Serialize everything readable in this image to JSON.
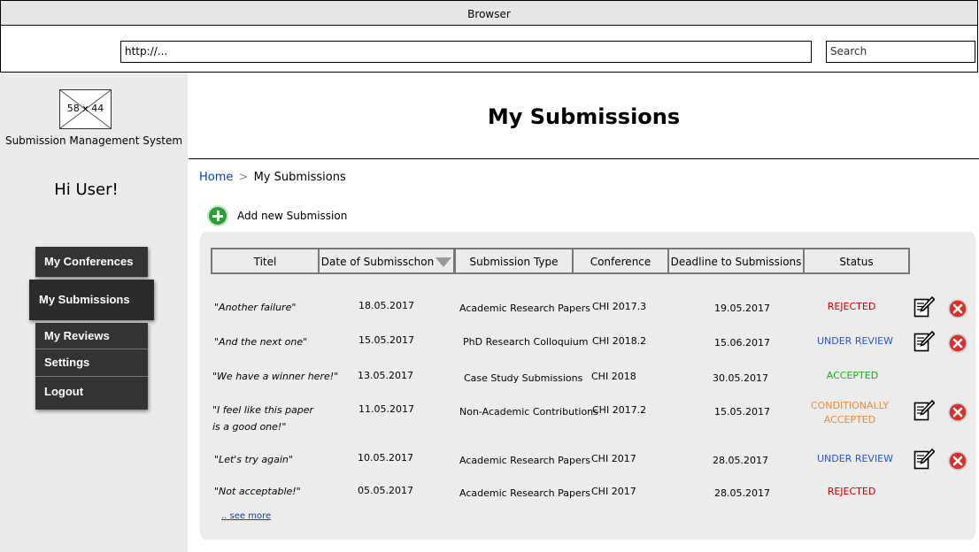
{
  "browser": {
    "title": "Browser",
    "url": "http://...",
    "search_placeholder": "Search"
  },
  "sidebar": {
    "logo_placeholder": "58 x 44",
    "app_name": "Submission Management System",
    "greeting": "Hi User!",
    "nav": [
      {
        "label": "My Conferences"
      },
      {
        "label": "My Submissions",
        "active": true
      },
      {
        "label": "My Reviews"
      },
      {
        "label": "Settings"
      },
      {
        "label": "Logout"
      }
    ]
  },
  "main": {
    "title": "My Submissions",
    "breadcrumb": {
      "home": "Home",
      "separator": ">",
      "current": "My Submissions"
    },
    "add_button": "Add new Submission",
    "table": {
      "headers": [
        "Titel",
        "Date of Submisschon",
        "Submission Type",
        "Conference",
        "Deadline to Submissions",
        "Status"
      ],
      "rows": [
        {
          "title": "\"Another failure\"",
          "date": "18.05.2017",
          "type": "Academic Research Papers",
          "conference": "CHI 2017.3",
          "deadline": "19.05.2017",
          "status": "REJECTED"
        },
        {
          "title": "\"And the next one\"",
          "date": "15.05.2017",
          "type": "PhD Research Colloquium",
          "conference": "CHI 2018.2",
          "deadline": "15.06.2017",
          "status": "UNDER REVIEW"
        },
        {
          "title": "\"We have a winner here!\"",
          "date": "13.05.2017",
          "type": "Case Study Submissions",
          "conference": "CHI 2018",
          "deadline": "30.05.2017",
          "status": "ACCEPTED"
        },
        {
          "title_line1": "\"I feel like this paper",
          "title_line2": "is a good one!\"",
          "date": "11.05.2017",
          "type": "Non-Academic Contributions",
          "conference": "CHI 2017.2",
          "deadline": "15.05.2017",
          "status_line1": "CONDITIONALLY",
          "status_line2": "ACCEPTED"
        },
        {
          "title": "\"Let's try again\"",
          "date": "10.05.2017",
          "type": "Academic Research Papers",
          "conference": "CHI 2017",
          "deadline": "28.05.2017",
          "status": "UNDER REVIEW"
        },
        {
          "title": "\"Not acceptable!\"",
          "date": "05.05.2017",
          "type": "Academic Research Papers",
          "conference": "CHI 2017",
          "deadline": "28.05.2017",
          "status": "REJECTED"
        }
      ]
    },
    "see_more": ".. see more"
  },
  "colors": {
    "status_rejected": "#cc0000",
    "status_under_review": "#2255dd",
    "status_accepted": "#22aa22",
    "status_conditional": "#f08838",
    "nav_bg": "#333333",
    "add_icon": "#2e9e3a",
    "delete_icon": "#d9302c"
  },
  "icons": {
    "add": "plus-circle-icon",
    "edit": "edit-document-icon",
    "delete": "delete-circle-icon",
    "sort": "sort-down-icon"
  }
}
